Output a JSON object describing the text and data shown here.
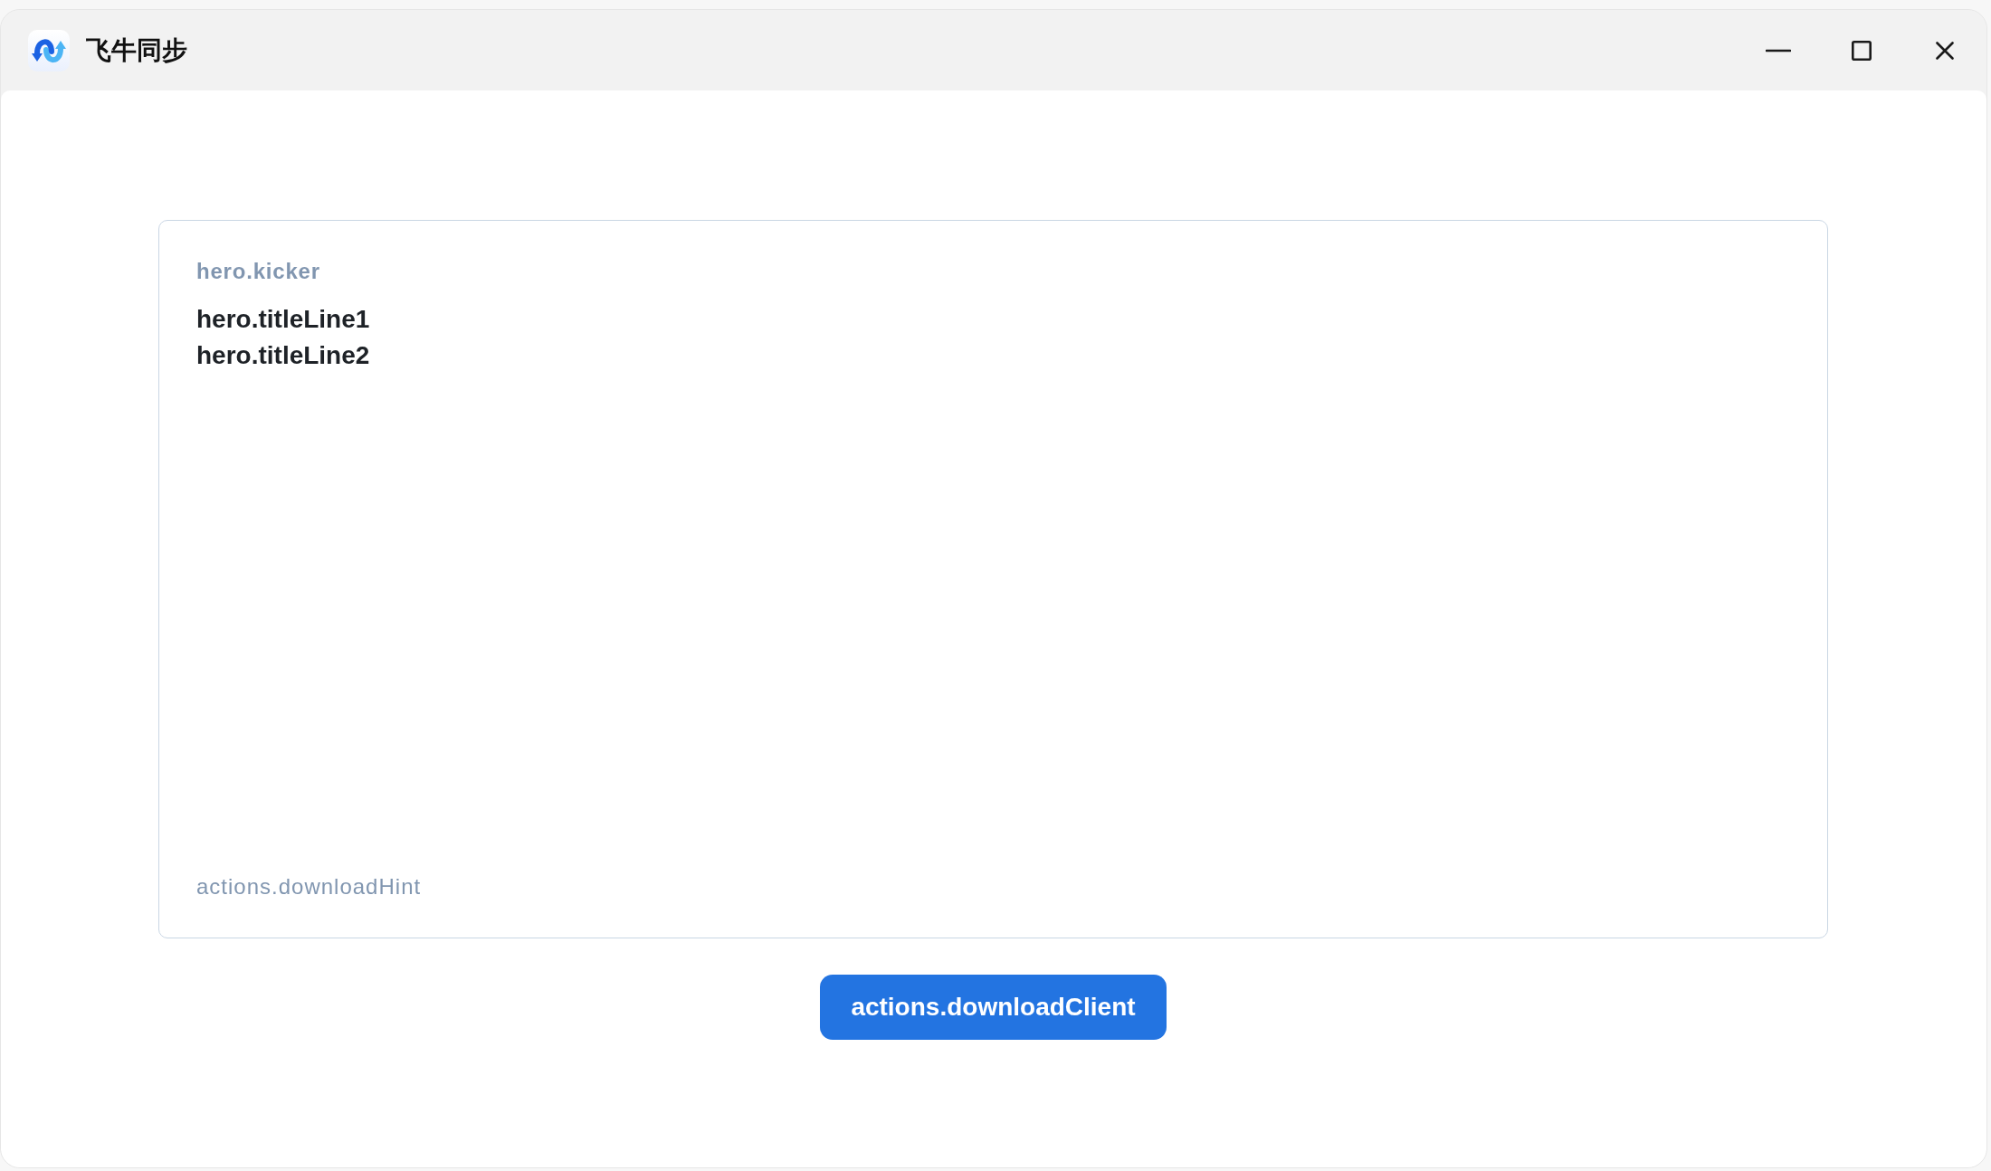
{
  "window": {
    "title": "飞牛同步"
  },
  "hero": {
    "kicker": "hero.kicker",
    "title_lines": [
      "hero.titleLine1",
      "hero.titleLine2"
    ],
    "hint": "actions.downloadHint"
  },
  "primary_button": {
    "label": "actions.downloadClient"
  }
}
